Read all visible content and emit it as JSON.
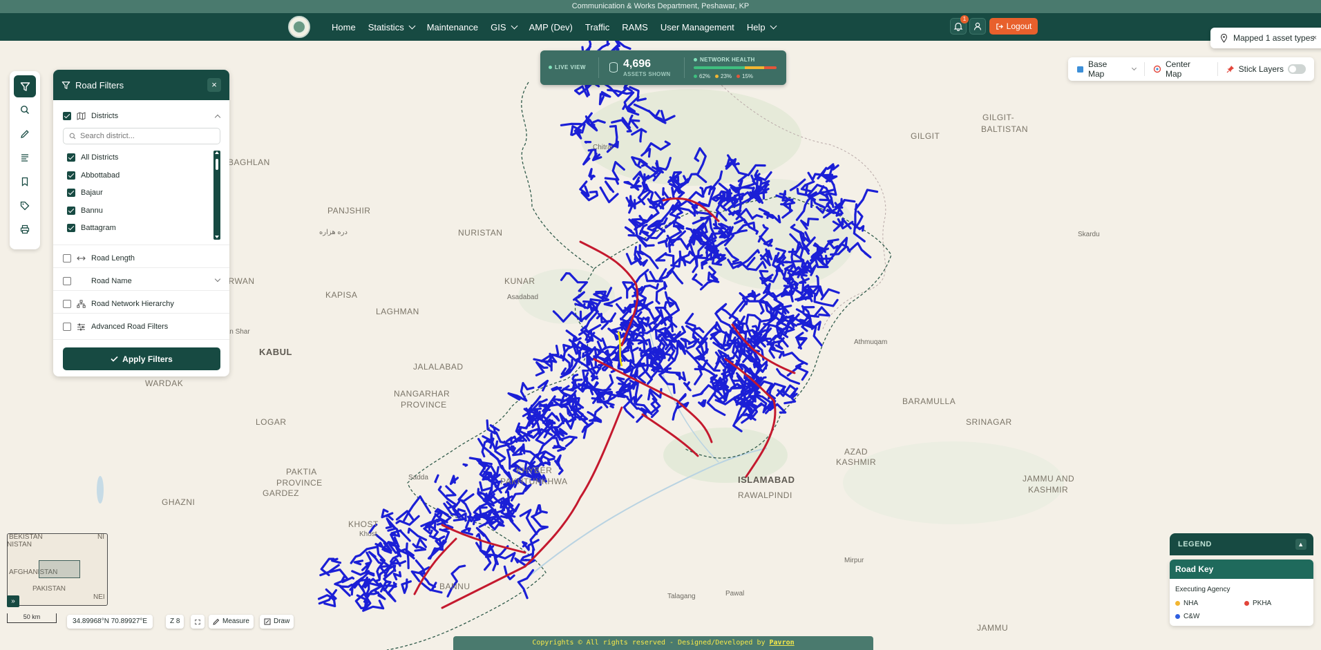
{
  "dept_bar": "Communication & Works Department, Peshawar, KP",
  "nav": {
    "items": [
      {
        "label": "Home",
        "dropdown": false
      },
      {
        "label": "Statistics",
        "dropdown": true
      },
      {
        "label": "Maintenance",
        "dropdown": false
      },
      {
        "label": "GIS",
        "dropdown": true
      },
      {
        "label": "AMP (Dev)",
        "dropdown": false
      },
      {
        "label": "Traffic",
        "dropdown": false
      },
      {
        "label": "RAMS",
        "dropdown": false
      },
      {
        "label": "User Management",
        "dropdown": false
      },
      {
        "label": "Help",
        "dropdown": true
      }
    ],
    "notification_count": "1",
    "logout_label": "Logout"
  },
  "toast": {
    "text": "Mapped 1 asset types",
    "close": "×"
  },
  "live_view": {
    "label": "LIVE VIEW",
    "count": "4,696",
    "count_label": "ASSETS SHOWN",
    "health_label": "NETWORK HEALTH",
    "health": [
      {
        "value": "62%",
        "color": "#3fbf7f"
      },
      {
        "value": "23%",
        "color": "#f2b632"
      },
      {
        "value": "15%",
        "color": "#e2563a"
      }
    ]
  },
  "map_controls": {
    "base_map": "Base Map",
    "center_map": "Center Map",
    "stick_layers": "Stick Layers",
    "stick_layers_on": false
  },
  "panel": {
    "title": "Road Filters",
    "close": "×",
    "districts_label": "Districts",
    "search_placeholder": "Search district...",
    "districts": [
      {
        "name": "All Districts",
        "checked": true
      },
      {
        "name": "Abbottabad",
        "checked": true
      },
      {
        "name": "Bajaur",
        "checked": true
      },
      {
        "name": "Bannu",
        "checked": true
      },
      {
        "name": "Battagram",
        "checked": true
      }
    ],
    "filters": [
      {
        "label": "Road Length",
        "icon": "arrows-horizontal-icon"
      },
      {
        "label": "Road Name",
        "icon": ""
      },
      {
        "label": "Road Network Hierarchy",
        "icon": "hierarchy-icon"
      },
      {
        "label": "Advanced Road Filters",
        "icon": "sliders-icon"
      }
    ],
    "apply_label": "Apply Filters"
  },
  "places": [
    {
      "text": "BAGHLAN",
      "style": ""
    },
    {
      "text": "PANJSHIR",
      "style": ""
    },
    {
      "text": "دره هزاره",
      "style": "sm"
    },
    {
      "text": "NURISTAN",
      "style": ""
    },
    {
      "text": "KAPISA",
      "style": ""
    },
    {
      "text": "LAGHMAN",
      "style": ""
    },
    {
      "text": "KUNAR",
      "style": ""
    },
    {
      "text": "Asadabad",
      "style": "sm"
    },
    {
      "text": "ARWAN",
      "style": ""
    },
    {
      "text": "KABUL",
      "style": "big"
    },
    {
      "text": "Kan Shar",
      "style": "sm"
    },
    {
      "text": "WARDAK",
      "style": ""
    },
    {
      "text": "JALALABAD",
      "style": ""
    },
    {
      "text": "NANGARHAR",
      "style": ""
    },
    {
      "text": "PROVINCE",
      "style": ""
    },
    {
      "text": "LOGAR",
      "style": ""
    },
    {
      "text": "PAKTIA",
      "style": ""
    },
    {
      "text": "PROVINCE",
      "style": ""
    },
    {
      "text": "GARDEZ",
      "style": ""
    },
    {
      "text": "GHAZNI",
      "style": ""
    },
    {
      "text": "Sadda",
      "style": "sm"
    },
    {
      "text": "KHOST",
      "style": ""
    },
    {
      "text": "Khost",
      "style": "sm"
    },
    {
      "text": "KHYBER",
      "style": ""
    },
    {
      "text": "PAKHTUNKHWA",
      "style": ""
    },
    {
      "text": "BANNU",
      "style": ""
    },
    {
      "text": "Talagang",
      "style": "sm"
    },
    {
      "text": "Pawal",
      "style": "sm"
    },
    {
      "text": "ISLAMABAD",
      "style": "big"
    },
    {
      "text": "RAWALPINDI",
      "style": ""
    },
    {
      "text": "AZAD",
      "style": ""
    },
    {
      "text": "KASHMIR",
      "style": ""
    },
    {
      "text": "Mirpur",
      "style": "sm"
    },
    {
      "text": "BARAMULLA",
      "style": ""
    },
    {
      "text": "SRINAGAR",
      "style": ""
    },
    {
      "text": "JAMMU AND",
      "style": ""
    },
    {
      "text": "KASHMIR",
      "style": ""
    },
    {
      "text": "JAMMU",
      "style": ""
    },
    {
      "text": "Athmuqam",
      "style": "sm"
    },
    {
      "text": "GILGIT",
      "style": ""
    },
    {
      "text": "GILGIT-",
      "style": ""
    },
    {
      "text": "BALTISTAN",
      "style": ""
    },
    {
      "text": "Skardu",
      "style": "sm"
    },
    {
      "text": "Chitral",
      "style": "sm"
    }
  ],
  "minimap": {
    "labels": [
      "BEKISTAN",
      "NISTAN",
      "AFGHANISTAN",
      "PAKISTAN",
      "NI",
      "NEI"
    ],
    "toggle": "»"
  },
  "scale": "50 km",
  "coordinates": "34.89968°N 70.89927°E",
  "zoom": "Z 8",
  "tools": {
    "measure": "Measure",
    "draw": "Draw"
  },
  "footer": {
    "text": "Copyrights © All rights reserved - Designed/Developed by ",
    "link": "Pavron"
  },
  "legend": {
    "title": "LEGEND",
    "toggle": "▲",
    "road_key": "Road Key",
    "agency_label": "Executing Agency",
    "agencies": [
      {
        "name": "NHA",
        "color": "#f2b632"
      },
      {
        "name": "PKHA",
        "color": "#e2453a"
      },
      {
        "name": "C&W",
        "color": "#2f5fe0"
      }
    ]
  }
}
